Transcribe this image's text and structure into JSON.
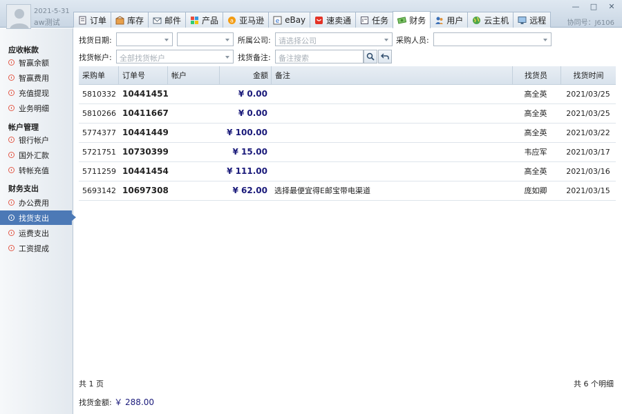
{
  "header": {
    "date": "2021-5-31",
    "user": "aw测试",
    "assist": "协同号：J6106",
    "win_controls": [
      "—",
      "□",
      "✕"
    ]
  },
  "tabs": [
    {
      "label": "订单",
      "icon": "document-icon",
      "active": false
    },
    {
      "label": "库存",
      "icon": "warehouse-icon",
      "active": false
    },
    {
      "label": "邮件",
      "icon": "envelope-icon",
      "active": false
    },
    {
      "label": "产品",
      "icon": "product-icon",
      "active": false
    },
    {
      "label": "亚马逊",
      "icon": "amazon-icon",
      "active": false
    },
    {
      "label": "eBay",
      "icon": "ebay-icon",
      "active": false
    },
    {
      "label": "速卖通",
      "icon": "aliexpress-icon",
      "active": false
    },
    {
      "label": "任务",
      "icon": "task-icon",
      "active": false
    },
    {
      "label": "财务",
      "icon": "money-icon",
      "active": true
    },
    {
      "label": "用户",
      "icon": "users-icon",
      "active": false
    },
    {
      "label": "云主机",
      "icon": "globe-icon",
      "active": false
    },
    {
      "label": "远程",
      "icon": "monitor-icon",
      "active": false
    }
  ],
  "sidebar": {
    "groups": [
      {
        "title": "应收帐款",
        "items": [
          "智赢余额",
          "智赢费用",
          "充值提现",
          "业务明细"
        ]
      },
      {
        "title": "帐户管理",
        "items": [
          "银行帐户",
          "国外汇款",
          "转帐充值"
        ]
      },
      {
        "title": "财务支出",
        "items": [
          "办公费用",
          "找货支出",
          "运费支出",
          "工资提成"
        ]
      }
    ],
    "active": "找货支出"
  },
  "filters": {
    "date_label": "找货日期:",
    "company_label": "所属公司:",
    "company_placeholder": "请选择公司",
    "buyer_label": "采购人员:",
    "account_label": "找货帐户:",
    "account_placeholder": "全部找货帐户",
    "note_label": "找货备注:",
    "note_placeholder": "备注搜索"
  },
  "table": {
    "columns": [
      "采购单",
      "订单号",
      "帐户",
      "金额",
      "备注",
      "找货员",
      "找货时间"
    ],
    "rows": [
      {
        "po": "5810332",
        "order": "10441451",
        "account": "",
        "amount": "¥ 0.00",
        "note": "",
        "buyer": "高全英",
        "date": "2021/03/25"
      },
      {
        "po": "5810266",
        "order": "10411667",
        "account": "",
        "amount": "¥ 0.00",
        "note": "",
        "buyer": "高全英",
        "date": "2021/03/25"
      },
      {
        "po": "5774377",
        "order": "10441449",
        "account": "",
        "amount": "¥ 100.00",
        "note": "",
        "buyer": "高全英",
        "date": "2021/03/22"
      },
      {
        "po": "5721751",
        "order": "10730399",
        "account": "",
        "amount": "¥ 15.00",
        "note": "",
        "buyer": "韦应军",
        "date": "2021/03/17"
      },
      {
        "po": "5711259",
        "order": "10441454",
        "account": "",
        "amount": "¥ 111.00",
        "note": "",
        "buyer": "高全英",
        "date": "2021/03/16"
      },
      {
        "po": "5693142",
        "order": "10697308",
        "account": "",
        "amount": "¥ 62.00",
        "note": "选择最便宜得E邮宝带电渠道",
        "buyer": "庞如卿",
        "date": "2021/03/15"
      }
    ]
  },
  "footer": {
    "pages": "共 1 页",
    "count": "共 6 个明细",
    "sum_label": "找货金额:",
    "sum_value": "￥ 288.00"
  }
}
